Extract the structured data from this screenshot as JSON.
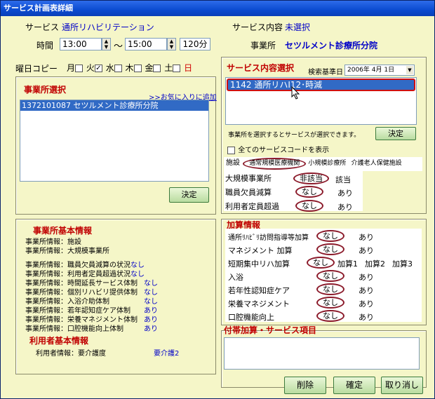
{
  "window": {
    "title": "サービス計画表詳細"
  },
  "top": {
    "service_label": "サービス",
    "service_value": "通所リハビリテーション",
    "content_label": "サービス内容",
    "content_value": "未選択",
    "time_label": "時間",
    "start_time": "13:00",
    "tilde": "～",
    "end_time": "15:00",
    "duration": "120分",
    "office_label": "事業所",
    "office_value": "セツルメント診療所分院"
  },
  "weekday": {
    "label": "曜日コピー",
    "days": [
      {
        "label": "月",
        "checked": false
      },
      {
        "label": "火",
        "checked": false
      },
      {
        "label": "水",
        "checked": true
      },
      {
        "label": "木",
        "checked": false
      },
      {
        "label": "金",
        "checked": false
      },
      {
        "label": "土",
        "checked": false
      },
      {
        "label": "日",
        "checked": false
      }
    ]
  },
  "office_select": {
    "title": "事業所選択",
    "favorite_link": ">>お気に入りに追加",
    "items": [
      "1372101087 セツルメント診療所分院"
    ],
    "decide": "決定"
  },
  "service_select": {
    "title": "サービス内容選択",
    "date_label": "検索基準日",
    "date_value": "2006年 4月 1日",
    "items": [
      "1142 通所リハⅠ12･時減"
    ],
    "hint": "事業所を選択するとサービスが選択できます。",
    "decide": "決定",
    "show_all": "全てのサービスコードを表示"
  },
  "facility": {
    "label": "施設",
    "options": [
      "通常規模医療機関",
      "小規模診療所",
      "介護老人保健施設"
    ],
    "selected": "通常規模医療機関"
  },
  "attrs": [
    {
      "label": "大規模事業所",
      "selected": "非該当",
      "other": "該当"
    },
    {
      "label": "職員欠員減算",
      "selected": "なし",
      "other": "あり"
    },
    {
      "label": "利用者定員超過",
      "selected": "なし",
      "other": "あり"
    }
  ],
  "office_info": {
    "title": "事業所基本情報",
    "lines": [
      {
        "label": "事業所情報：施設",
        "value": ""
      },
      {
        "label": "事業所情報：大規模事業所",
        "value": ""
      },
      {
        "label": "事業所情報：職員欠員減算の状況",
        "value": "なし"
      },
      {
        "label": "事業所情報：利用者定員超過状況",
        "value": "なし"
      },
      {
        "label": "事業所情報：時間延長サービス体制",
        "value": "なし"
      },
      {
        "label": "事業所情報：個別リハビリ提供体制",
        "value": "なし"
      },
      {
        "label": "事業所情報：入浴介助体制",
        "value": "なし"
      },
      {
        "label": "事業所情報：若年認知症ケア体制",
        "value": "あり"
      },
      {
        "label": "事業所情報：栄養マネジメント体制",
        "value": "あり"
      },
      {
        "label": "事業所情報：口腔機能向上体制",
        "value": "あり"
      }
    ]
  },
  "user_info": {
    "title": "利用者基本情報",
    "label": "利用者情報：要介護度",
    "value": "要介護2"
  },
  "addition": {
    "title": "加算情報",
    "rows": [
      {
        "label": "通所ﾘﾊﾋﾞﾘ訪問指導等加算",
        "selected": "なし",
        "others": [
          "あり"
        ]
      },
      {
        "label": "マネジメント 加算",
        "selected": "なし",
        "others": [
          "あり"
        ]
      },
      {
        "label": "短期集中リハ加算",
        "selected": "なし",
        "others": [
          "加算1",
          "加算2",
          "加算3"
        ]
      },
      {
        "label": "入浴",
        "selected": "なし",
        "others": [
          "あり"
        ]
      },
      {
        "label": "若年性認知症ケア",
        "selected": "なし",
        "others": [
          "あり"
        ]
      },
      {
        "label": "栄養マネジメント",
        "selected": "なし",
        "others": [
          "あり"
        ]
      },
      {
        "label": "口腔機能向上",
        "selected": "なし",
        "others": [
          "あり"
        ]
      }
    ]
  },
  "extra": {
    "title": "付帯加算・サービス項目"
  },
  "buttons": {
    "delete": "削除",
    "confirm": "確定",
    "cancel": "取り消し"
  }
}
